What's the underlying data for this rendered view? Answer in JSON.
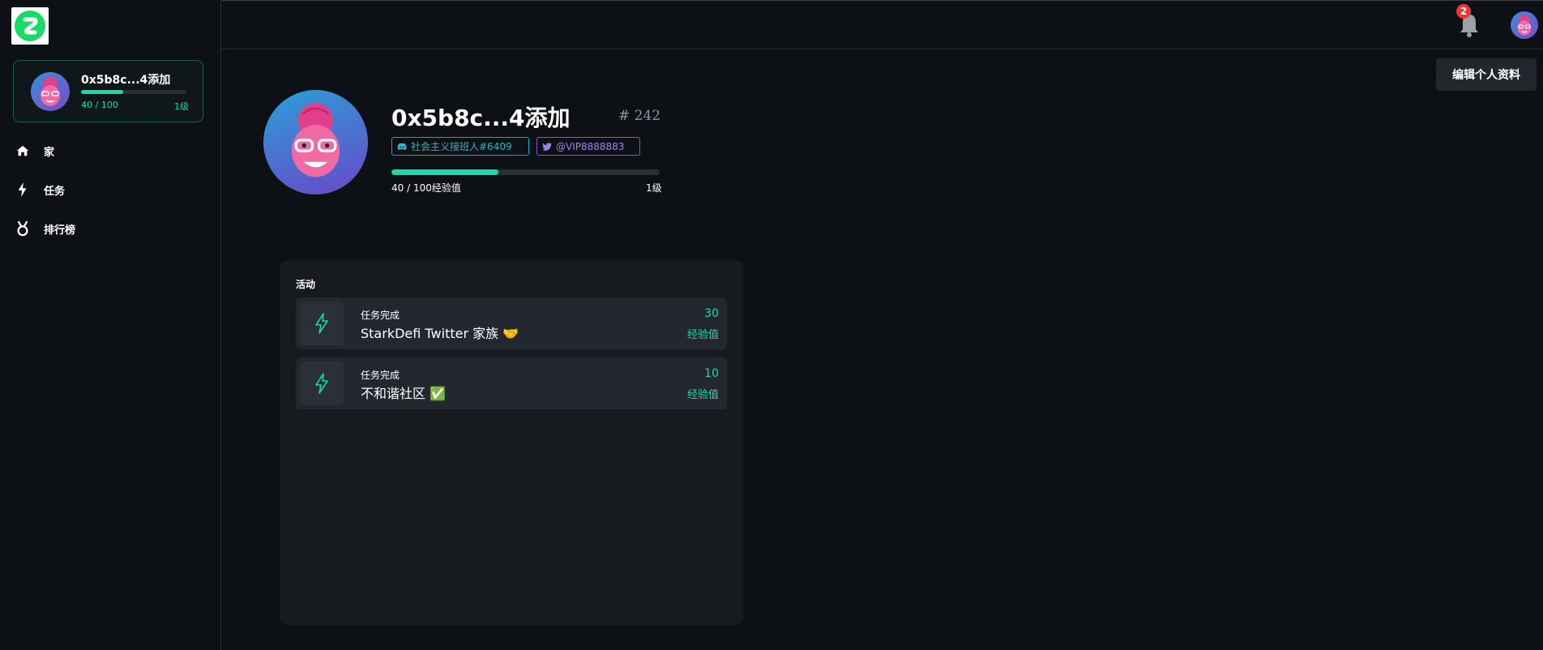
{
  "brand": {
    "logo_color": "#19d96a"
  },
  "sidebar": {
    "user": {
      "name": "0x5b8c...4添加",
      "xp_text": "40 / 100",
      "level_text": "1级",
      "progress": 0.4
    },
    "items": [
      {
        "icon": "home-icon",
        "label": "家"
      },
      {
        "icon": "bolt-icon",
        "label": "任务"
      },
      {
        "icon": "medal-icon",
        "label": "排行榜"
      }
    ]
  },
  "topbar": {
    "notification_count": "2"
  },
  "profile": {
    "edit_label": "编辑个人资料",
    "name": "0x5b8c...4添加",
    "rank": "# 242",
    "discord": "社会主义接班人#6409",
    "twitter": "@VIP8888883",
    "xp_text": "40 / 100经验值",
    "level_text": "1级",
    "progress": 0.4
  },
  "activity": {
    "title": "活动",
    "items": [
      {
        "kind": "任务完成",
        "title": "StarkDefi Twitter 家族 🤝",
        "points": "30",
        "unit": "经验值"
      },
      {
        "kind": "任务完成",
        "title": "不和谐社区 ✅",
        "points": "10",
        "unit": "经验值"
      }
    ]
  },
  "colors": {
    "accent": "#19d9a8",
    "background": "#0d1014",
    "panel": "#171b20",
    "badge": "#e53935"
  }
}
